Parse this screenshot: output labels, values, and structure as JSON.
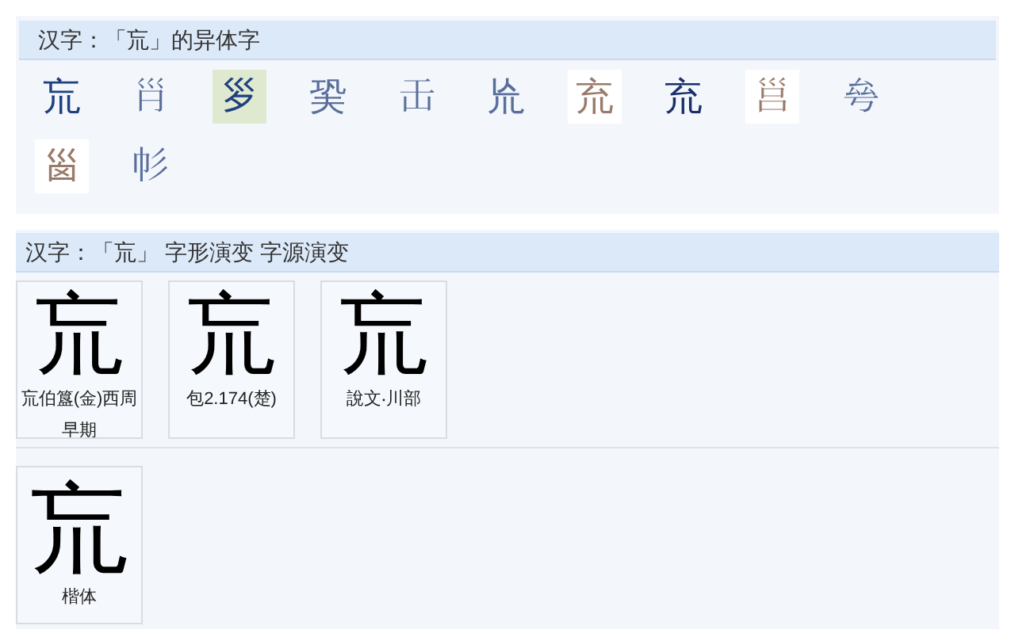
{
  "variants_panel": {
    "title": "汉字：「巟」的异体字",
    "variants": [
      {
        "char": "巟",
        "color": "#1f3f80",
        "selected": false,
        "kind": "text"
      },
      {
        "char": "𡿩",
        "color": "#5a6e9a",
        "selected": false,
        "kind": "text"
      },
      {
        "char": "𡿪",
        "color": "#1f3f80",
        "selected": true,
        "kind": "text"
      },
      {
        "char": "㠫",
        "color": "#5a6e9a",
        "selected": false,
        "kind": "text"
      },
      {
        "char": "𠙻",
        "color": "#5a6e9a",
        "selected": false,
        "kind": "text"
      },
      {
        "char": "㠩",
        "color": "#5a6e9a",
        "selected": false,
        "kind": "text"
      },
      {
        "char": "㐬",
        "color": "#9a7a6a",
        "selected": false,
        "kind": "image"
      },
      {
        "char": "㐬",
        "color": "#1a2f6a",
        "selected": false,
        "kind": "text"
      },
      {
        "char": "𡿷",
        "color": "#9a7a6a",
        "selected": false,
        "kind": "image"
      },
      {
        "char": "𠫫",
        "color": "#5a6e9a",
        "selected": false,
        "kind": "text"
      },
      {
        "char": "𡿺",
        "color": "#9a7a6a",
        "selected": false,
        "kind": "image"
      },
      {
        "char": "𢁘",
        "color": "#5a6e9a",
        "selected": false,
        "kind": "text"
      }
    ]
  },
  "evolution_panel": {
    "title": "汉字：「巟」 字形演变 字源演变",
    "forms": [
      {
        "glyph": "巟",
        "caption": "巟伯簋(金)西周早期"
      },
      {
        "glyph": "巟",
        "caption": "包2.174(楚)"
      },
      {
        "glyph": "巟",
        "caption": "說文‧川部"
      }
    ],
    "standard_forms": [
      {
        "glyph": "巟",
        "caption": "楷体"
      }
    ]
  }
}
